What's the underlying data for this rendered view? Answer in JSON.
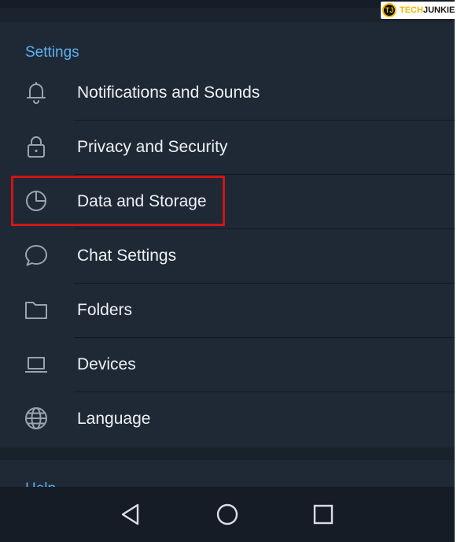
{
  "watermark": {
    "logo_letters": "TJ",
    "part1": "TECH",
    "part2": "JUNKIE"
  },
  "settings": {
    "section_title": "Settings",
    "items": [
      {
        "label": "Notifications and Sounds",
        "icon": "bell-icon"
      },
      {
        "label": "Privacy and Security",
        "icon": "lock-icon"
      },
      {
        "label": "Data and Storage",
        "icon": "pie-chart-icon",
        "highlighted": true
      },
      {
        "label": "Chat Settings",
        "icon": "chat-bubble-icon"
      },
      {
        "label": "Folders",
        "icon": "folder-icon"
      },
      {
        "label": "Devices",
        "icon": "laptop-icon"
      },
      {
        "label": "Language",
        "icon": "globe-icon"
      }
    ]
  },
  "next_section": {
    "title": "Help"
  },
  "navbar": {
    "back_icon": "back-triangle-icon",
    "home_icon": "home-circle-icon",
    "recents_icon": "recents-square-icon"
  },
  "colors": {
    "background": "#1f2936",
    "accent": "#5eb0ee",
    "text": "#eef1f4",
    "icon": "#9aa3ad",
    "highlight_border": "#d01515"
  }
}
